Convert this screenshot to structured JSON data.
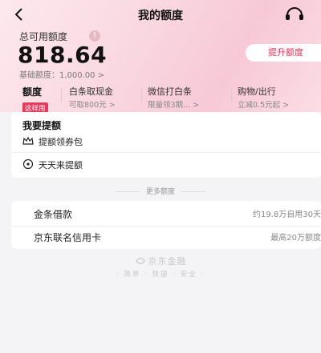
{
  "header": {
    "title": "我的额度"
  },
  "credit": {
    "available_label": "总可用额度",
    "available_amount": "818.64",
    "raise_button": "提升额度",
    "base_label": "基础额度：1,000.00 >"
  },
  "tabs": [
    {
      "title": "额度",
      "tag": "这样用"
    },
    {
      "title": "白条取现金",
      "subtitle": "可取800元 >"
    },
    {
      "title": "微信打白条",
      "subtitle": "限量领3期... >"
    },
    {
      "title": "购物/出行",
      "subtitle": "立减0.5元起 >"
    }
  ],
  "raise_section": {
    "heading": "我要提额",
    "items": [
      {
        "label": "提额领券包",
        "icon": "crown-icon"
      },
      {
        "label": "天天来提额",
        "icon": "target-icon"
      }
    ]
  },
  "more_section": {
    "label": "更多额度",
    "items": [
      {
        "name": "金条借款",
        "desc": "约19.8万自用30天"
      },
      {
        "name": "京东联名信用卡",
        "desc": "最高20万额度"
      }
    ]
  },
  "footer": {
    "brand": "京东金融",
    "slogan": "· 简单 · 快捷 · 安全 ·"
  },
  "colors": {
    "accent": "#e0335a",
    "tag": "#e63a5c",
    "hero": "#f9d6e0"
  }
}
